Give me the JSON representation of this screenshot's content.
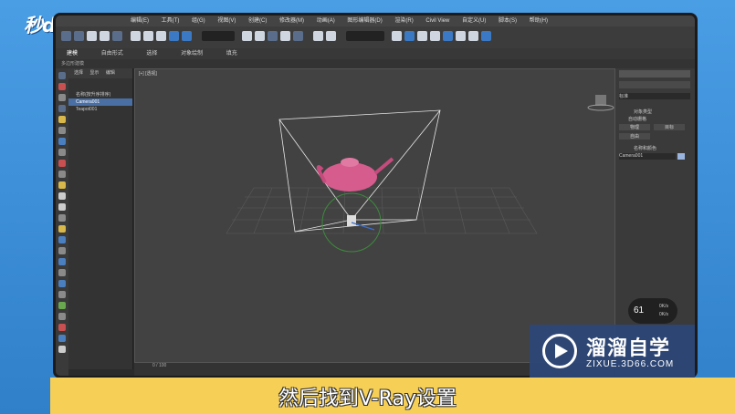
{
  "logo": "秒dong视频",
  "menu": [
    "编辑(E)",
    "工具(T)",
    "组(G)",
    "视图(V)",
    "创建(C)",
    "修改器(M)",
    "动画(A)",
    "图形编辑器(D)",
    "渲染(R)",
    "Civil View",
    "自定义(U)",
    "脚本(S)",
    "帮助(H)"
  ],
  "tabs": [
    "建模",
    "自由形式",
    "选择",
    "对象绘制",
    "填充"
  ],
  "ribbon_label": "多边形建模",
  "scene_tabs": [
    "选择",
    "显示",
    "编辑"
  ],
  "scene_header": "名称(按升序排序)",
  "scene_items": [
    "Camera001",
    "Teapot001"
  ],
  "viewport_label": "[+] [透视]",
  "right_panel": {
    "dropdown": "标准",
    "section1": "对象类型",
    "auto_grid": "自动栅格",
    "btn1": "物理",
    "btn2": "目标",
    "btn3": "自由",
    "section2": "名称和颜色",
    "name_value": "Camera001"
  },
  "timeline": "0 / 100",
  "gauge": {
    "value": "61",
    "unit": "%",
    "r1": "0K/s",
    "r2": "0K/s"
  },
  "subtitle": "然后找到V-Ray设置",
  "watermark": {
    "title": "溜溜自学",
    "sub": "ZIXUE.3D66.COM"
  }
}
